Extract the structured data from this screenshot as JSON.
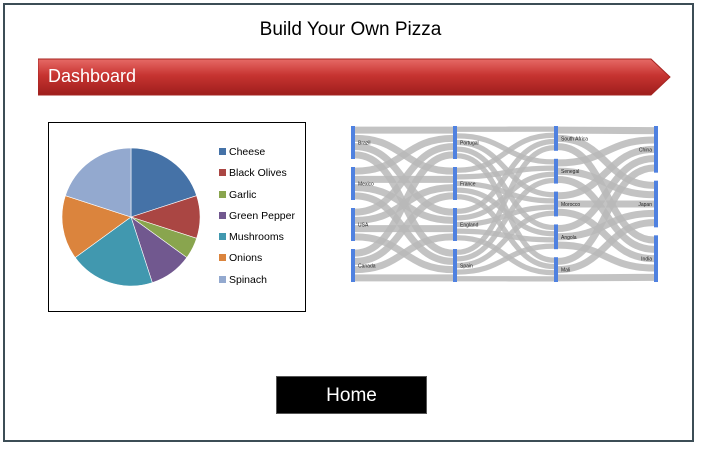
{
  "header": {
    "title": "Build Your Own Pizza"
  },
  "banner": {
    "label": "Dashboard",
    "color": "#c0302e"
  },
  "pie_chart": {
    "chart_data": {
      "type": "pie",
      "categories": [
        "Cheese",
        "Black Olives",
        "Garlic",
        "Green Pepper",
        "Mushrooms",
        "Onions",
        "Spinach"
      ],
      "values": [
        20,
        10,
        5,
        10,
        20,
        15,
        20
      ],
      "colors": [
        "#4572a7",
        "#aa4643",
        "#89a54e",
        "#71588f",
        "#4198af",
        "#db843d",
        "#93a9cf"
      ],
      "legend_position": "right"
    }
  },
  "sankey": {
    "chart_data": {
      "type": "sankey",
      "columns": [
        [
          "Brazil",
          "Mexico",
          "USA",
          "Canada"
        ],
        [
          "Portugal",
          "France",
          "England",
          "Spain"
        ],
        [
          "South Africa",
          "Senegal",
          "Morocco",
          "Angola",
          "Mali"
        ],
        [
          "China",
          "Japan",
          "India"
        ]
      ],
      "bar_color": "#4f81e0",
      "link_color": "#b8b8b8"
    }
  },
  "home_button": {
    "label": "Home"
  }
}
